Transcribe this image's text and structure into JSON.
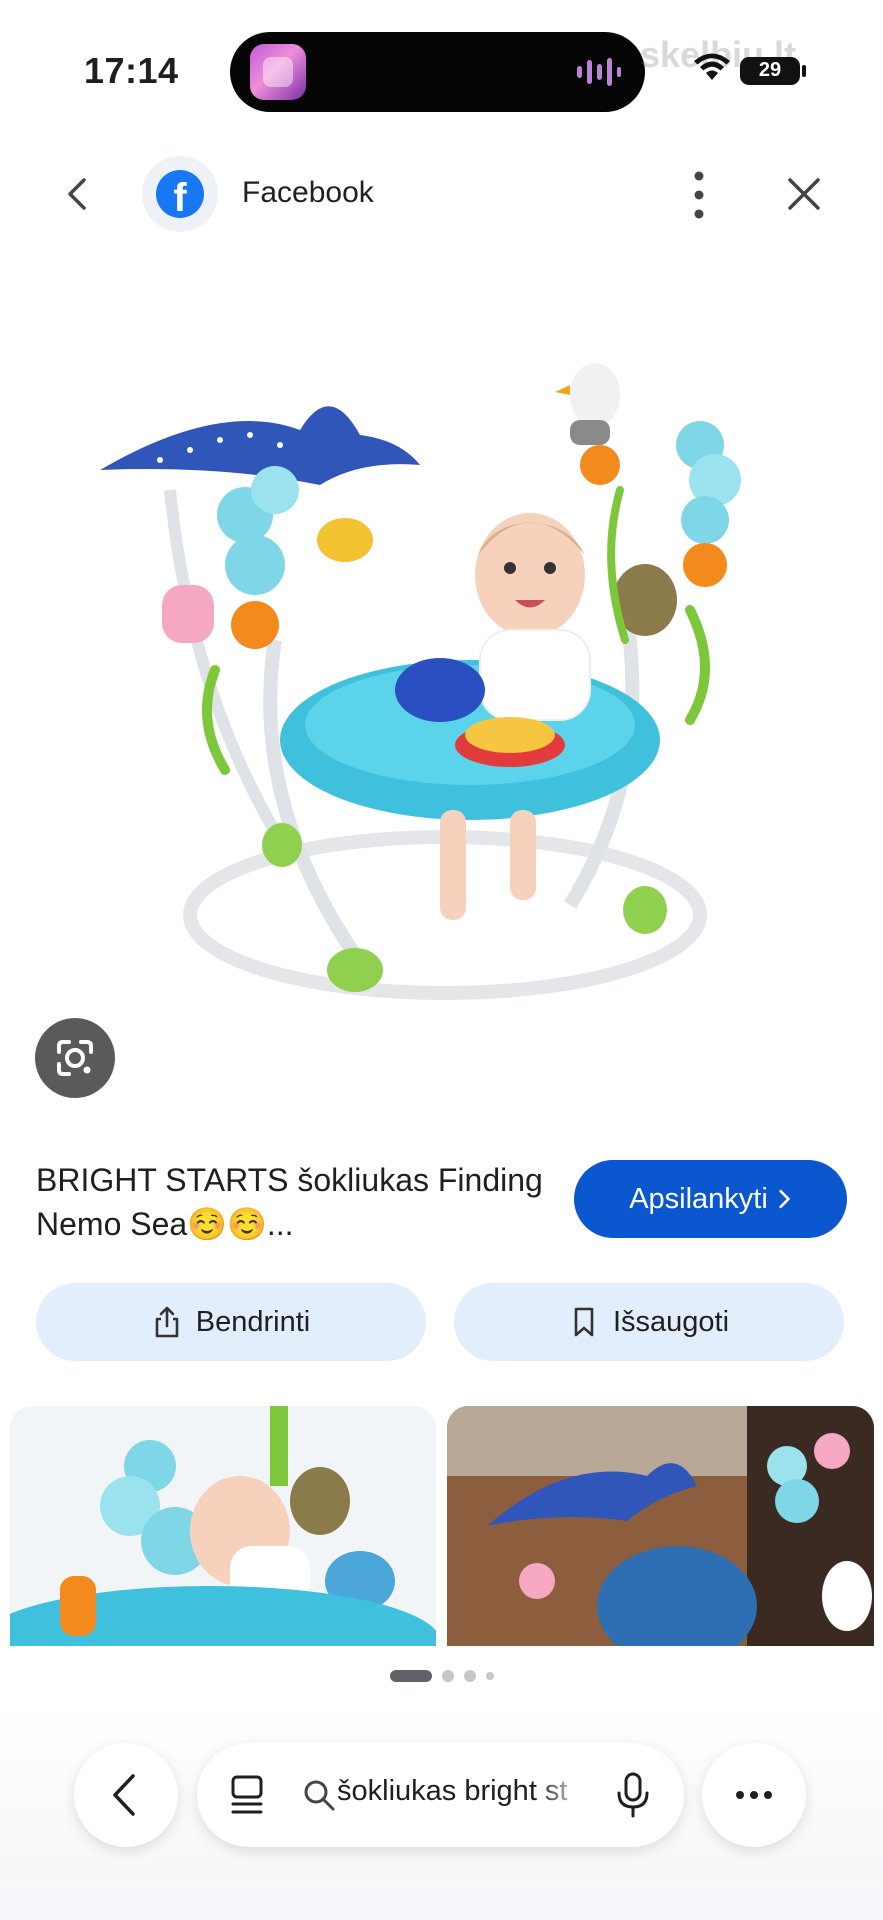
{
  "status_bar": {
    "time": "17:14",
    "watermark": "skelbiu.lt",
    "battery": "29"
  },
  "header": {
    "source": "Facebook",
    "icons": [
      "back-icon",
      "facebook-logo",
      "more-vert-icon",
      "close-icon"
    ]
  },
  "result": {
    "title": "BRIGHT STARTS šokliukas Finding Nemo Sea☺️☺️...",
    "visit_label": "Apsilankyti",
    "share_label": "Bendrinti",
    "save_label": "Išsaugoti"
  },
  "pager": {
    "count": 4,
    "active": 1
  },
  "bottom_bar": {
    "search_query": "šokliukas bright st",
    "icons": [
      "back-icon",
      "tabs-icon",
      "search-icon",
      "mic-icon",
      "more-horiz-icon"
    ]
  },
  "colors": {
    "accent": "#0b57d0",
    "action_bg": "#e3eefc",
    "facebook": "#1877f2"
  }
}
